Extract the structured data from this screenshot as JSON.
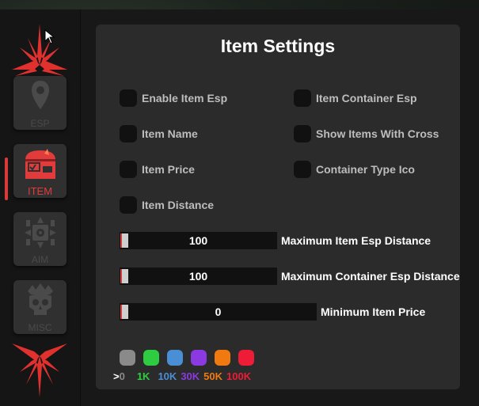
{
  "sidebar": {
    "items": [
      {
        "label": "ESP",
        "icon": "location-pin-icon",
        "active": false
      },
      {
        "label": "ITEM",
        "icon": "treasure-chest-icon",
        "active": true
      },
      {
        "label": "AIM",
        "icon": "crosshair-icon",
        "active": false
      },
      {
        "label": "MISC",
        "icon": "skull-icon",
        "active": false
      }
    ],
    "accent": "#d93a3a"
  },
  "panel": {
    "title": "Item Settings",
    "options_left": [
      {
        "label": "Enable Item Esp",
        "checked": false
      },
      {
        "label": "Item Name",
        "checked": false
      },
      {
        "label": "Item Price",
        "checked": false
      },
      {
        "label": "Item Distance",
        "checked": false
      }
    ],
    "options_right": [
      {
        "label": "Item Container Esp",
        "checked": false
      },
      {
        "label": "Show Items With Cross",
        "checked": false
      },
      {
        "label": "Container Type Ico",
        "checked": false
      }
    ],
    "sliders": [
      {
        "value": "100",
        "label": "Maximum Item Esp Distance",
        "fraction": 0.0
      },
      {
        "value": "100",
        "label": "Maximum Container Esp Distance",
        "fraction": 0.0
      },
      {
        "value": "0",
        "label": "Minimum Item Price",
        "fraction": 0.0
      }
    ],
    "price_tiers": [
      {
        "prefix": "> ",
        "label": "0",
        "color": "#8a8a8a"
      },
      {
        "prefix": "",
        "label": "1K",
        "color": "#2ecc40"
      },
      {
        "prefix": "",
        "label": "10K",
        "color": "#4a8fd6"
      },
      {
        "prefix": "",
        "label": "30K",
        "color": "#8a3ae0"
      },
      {
        "prefix": "",
        "label": "50K",
        "color": "#f07a10"
      },
      {
        "prefix": "",
        "label": "100K",
        "color": "#ee1c36"
      }
    ]
  }
}
